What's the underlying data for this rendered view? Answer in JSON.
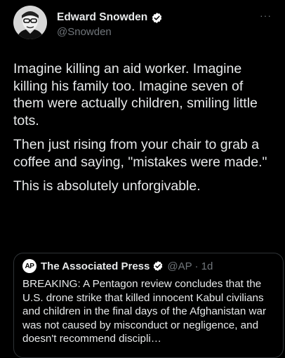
{
  "author": {
    "display_name": "Edward Snowden",
    "handle": "@Snowden",
    "verified": true,
    "avatar_icon": "snowden-portrait-avatar",
    "more_label": "···"
  },
  "tweet": {
    "paragraphs": [
      "Imagine killing an aid worker. Imagine killing his family too. Imagine seven of them were actually children, smiling little tots.",
      "Then just rising from your chair to grab a coffee and saying, \"mistakes were made.\"",
      "This is absolutely unforgivable."
    ]
  },
  "quoted": {
    "logo_text": "AP",
    "display_name": "The Associated Press",
    "verified": true,
    "handle_time": "@AP · 1d",
    "text": "BREAKING: A Pentagon review concludes that the U.S. drone strike that killed innocent Kabul civilians and children in the final days of the Afghanistan war was not caused by misconduct or negligence, and doesn't recommend discipli…"
  },
  "colors": {
    "background": "#000000",
    "text_primary": "#e7e9ea",
    "text_secondary": "#71767b",
    "verified_blue": "#1d9bf0",
    "border": "#2f3336"
  }
}
